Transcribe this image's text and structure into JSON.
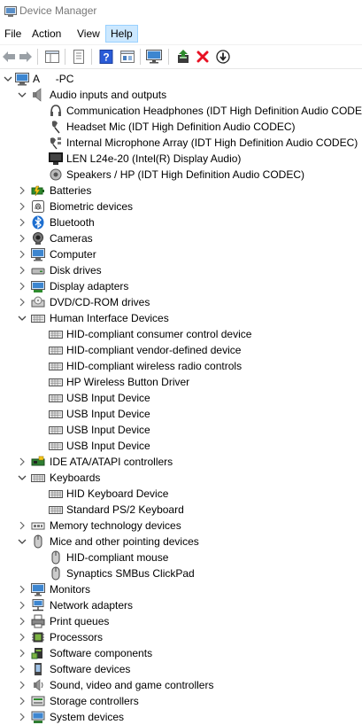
{
  "window": {
    "title": "Device Manager"
  },
  "menu": {
    "items": [
      "File",
      "Action",
      "View",
      "Help"
    ]
  },
  "toolbar": {
    "buttons": [
      "back-icon",
      "forward-icon",
      "show-hide-tree-icon",
      "properties-icon",
      "help-icon",
      "view-icon",
      "monitor-icon",
      "update-driver-icon",
      "uninstall-icon",
      "disable-icon"
    ]
  },
  "tree": {
    "root": {
      "label": "A    -PC"
    },
    "rows": [
      {
        "label": "Audio inputs and outputs",
        "level": 1,
        "expanded": true,
        "icon": "speaker-icon"
      },
      {
        "label": "Communication Headphones (IDT High Definition Audio CODEC)",
        "level": 2,
        "icon": "headphones-icon"
      },
      {
        "label": "Headset Mic (IDT High Definition Audio CODEC)",
        "level": 2,
        "icon": "microphone-icon"
      },
      {
        "label": "Internal Microphone Array (IDT High Definition Audio CODEC)",
        "level": 2,
        "icon": "microphone-array-icon"
      },
      {
        "label": "LEN L24e-20 (Intel(R) Display Audio)",
        "level": 2,
        "icon": "monitor-audio-icon"
      },
      {
        "label": "Speakers / HP (IDT High Definition Audio CODEC)",
        "level": 2,
        "icon": "speaker-device-icon"
      },
      {
        "label": "Batteries",
        "level": 1,
        "expanded": false,
        "icon": "battery-icon"
      },
      {
        "label": "Biometric devices",
        "level": 1,
        "expanded": false,
        "icon": "fingerprint-icon"
      },
      {
        "label": "Bluetooth",
        "level": 1,
        "expanded": false,
        "icon": "bluetooth-icon"
      },
      {
        "label": "Cameras",
        "level": 1,
        "expanded": false,
        "icon": "camera-icon"
      },
      {
        "label": "Computer",
        "level": 1,
        "expanded": false,
        "icon": "computer-icon"
      },
      {
        "label": "Disk drives",
        "level": 1,
        "expanded": false,
        "icon": "disk-icon"
      },
      {
        "label": "Display adapters",
        "level": 1,
        "expanded": false,
        "icon": "display-adapter-icon"
      },
      {
        "label": "DVD/CD-ROM drives",
        "level": 1,
        "expanded": false,
        "icon": "dvd-icon"
      },
      {
        "label": "Human Interface Devices",
        "level": 1,
        "expanded": true,
        "icon": "hid-icon"
      },
      {
        "label": "HID-compliant consumer control device",
        "level": 2,
        "icon": "hid-icon"
      },
      {
        "label": "HID-compliant vendor-defined device",
        "level": 2,
        "icon": "hid-icon"
      },
      {
        "label": "HID-compliant wireless radio controls",
        "level": 2,
        "icon": "hid-icon"
      },
      {
        "label": "HP Wireless Button Driver",
        "level": 2,
        "icon": "hid-icon"
      },
      {
        "label": "USB Input Device",
        "level": 2,
        "icon": "hid-icon"
      },
      {
        "label": "USB Input Device",
        "level": 2,
        "icon": "hid-icon"
      },
      {
        "label": "USB Input Device",
        "level": 2,
        "icon": "hid-icon"
      },
      {
        "label": "USB Input Device",
        "level": 2,
        "icon": "hid-icon"
      },
      {
        "label": "IDE ATA/ATAPI controllers",
        "level": 1,
        "expanded": false,
        "icon": "ide-icon"
      },
      {
        "label": "Keyboards",
        "level": 1,
        "expanded": true,
        "icon": "keyboard-icon"
      },
      {
        "label": "HID Keyboard Device",
        "level": 2,
        "icon": "keyboard-icon"
      },
      {
        "label": "Standard PS/2 Keyboard",
        "level": 2,
        "icon": "keyboard-icon"
      },
      {
        "label": "Memory technology devices",
        "level": 1,
        "expanded": false,
        "icon": "memory-icon"
      },
      {
        "label": "Mice and other pointing devices",
        "level": 1,
        "expanded": true,
        "icon": "mouse-icon"
      },
      {
        "label": "HID-compliant mouse",
        "level": 2,
        "icon": "mouse-icon"
      },
      {
        "label": "Synaptics SMBus ClickPad",
        "level": 2,
        "icon": "mouse-icon"
      },
      {
        "label": "Monitors",
        "level": 1,
        "expanded": false,
        "icon": "monitor-icon"
      },
      {
        "label": "Network adapters",
        "level": 1,
        "expanded": false,
        "icon": "network-icon"
      },
      {
        "label": "Print queues",
        "level": 1,
        "expanded": false,
        "icon": "printer-icon"
      },
      {
        "label": "Processors",
        "level": 1,
        "expanded": false,
        "icon": "processor-icon"
      },
      {
        "label": "Software components",
        "level": 1,
        "expanded": false,
        "icon": "software-component-icon"
      },
      {
        "label": "Software devices",
        "level": 1,
        "expanded": false,
        "icon": "software-device-icon"
      },
      {
        "label": "Sound, video and game controllers",
        "level": 1,
        "expanded": false,
        "icon": "sound-icon"
      },
      {
        "label": "Storage controllers",
        "level": 1,
        "expanded": false,
        "icon": "storage-icon"
      },
      {
        "label": "System devices",
        "level": 1,
        "expanded": false,
        "icon": "system-icon"
      }
    ]
  },
  "colors": {
    "menu_highlight": "#cce8ff",
    "folder_blue": "#1e7fd6",
    "help_blue": "#2a5bd7",
    "uninstall_red": "#e81123",
    "update_green": "#2e8b2e"
  }
}
